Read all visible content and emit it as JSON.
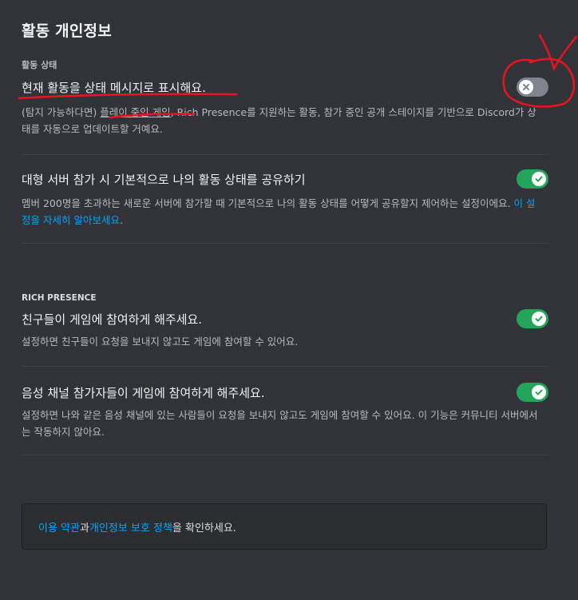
{
  "page": {
    "title": "활동 개인정보"
  },
  "activity_status": {
    "header": "활동 상태",
    "title": "현재 활동을 상태 메시지로 표시해요.",
    "desc_part1": "(탐지 가능하다면) ",
    "desc_link": "플레이 중인 게임",
    "desc_part2": ", Rich Presence를 지원하는 활동, 참가 중인 공개 스테이지를 기반으로 Discord가 상태를 자동으로 업데이트할 거예요.",
    "enabled": false
  },
  "share_activity": {
    "title": "대형 서버 참가 시 기본적으로 나의 활동 상태를 공유하기",
    "desc": "멤버 200명을 초과하는 새로운 서버에 참가할 때 기본적으로 나의 활동 상태를 어떻게 공유할지 제어하는 설정이에요. ",
    "link": "이 설정을 자세히 알아보세요",
    "desc_end": ".",
    "enabled": true
  },
  "rich_presence": {
    "header": "RICH PRESENCE",
    "friends_join": {
      "title": "친구들이 게임에 참여하게 해주세요.",
      "desc": "설정하면 친구들이 요청을 보내지 않고도 게임에 참여할 수 있어요.",
      "enabled": true
    },
    "voice_join": {
      "title": "음성 채널 참가자들이 게임에 참여하게 해주세요.",
      "desc": "설정하면 나와 같은 음성 채널에 있는 사람들이 요청을 보내지 않고도 게임에 참여할 수 있어요. 이 기능은 커뮤니티 서버에서는 작동하지 않아요.",
      "enabled": true
    }
  },
  "notice": {
    "terms_link": "이용 약관",
    "text1": "과 ",
    "privacy_link": "개인정보 보호 정책",
    "text2": "을 확인하세요."
  },
  "colors": {
    "background": "#313338",
    "toggle_on": "#23a55a",
    "toggle_off": "#80848e",
    "link": "#00a8fc",
    "annotation": "#e8141e"
  }
}
